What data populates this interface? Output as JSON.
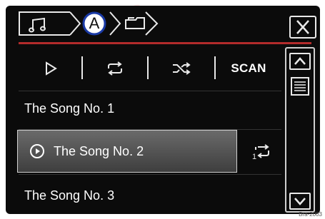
{
  "breadcrumb": {
    "items": [
      {
        "icon": "music-note-icon"
      },
      {
        "label": "A"
      },
      {
        "icon": "folders-icon"
      }
    ]
  },
  "controls": {
    "scan_label": "SCAN"
  },
  "playlist": {
    "items": [
      {
        "title": "The Song No. 1",
        "selected": false
      },
      {
        "title": "The Song No. 2",
        "selected": true
      },
      {
        "title": "The Song No. 3",
        "selected": false
      }
    ]
  },
  "figure_code": "Bra-2003",
  "colors": {
    "background": "#0b0b0b",
    "accent_line": "#b32b2b",
    "selected_bg": "#555555",
    "text": "#ffffff",
    "callout_ring": "#1a3aa6"
  }
}
